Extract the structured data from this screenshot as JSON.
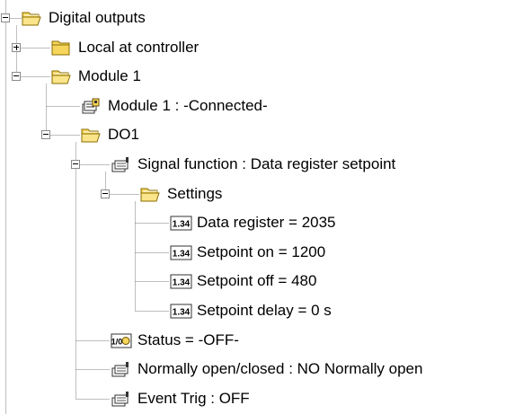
{
  "tree": {
    "nodes": [
      {
        "id": "n0",
        "level": 0,
        "label": "Digital outputs",
        "icon": "folder-open-icon",
        "expander": "expanded"
      },
      {
        "id": "n1",
        "level": 1,
        "label": "Local at controller",
        "icon": "folder-closed-icon",
        "expander": "collapsed"
      },
      {
        "id": "n2",
        "level": 1,
        "label": "Module 1",
        "icon": "folder-open-icon",
        "expander": "expanded"
      },
      {
        "id": "n3",
        "level": 2,
        "label": "Module 1 : -Connected-",
        "icon": "module-icon",
        "expander": "none"
      },
      {
        "id": "n4",
        "level": 2,
        "label": "DO1",
        "icon": "folder-open-icon",
        "expander": "expanded"
      },
      {
        "id": "n5",
        "level": 3,
        "label": "Signal function : Data register setpoint",
        "icon": "parameter-icon",
        "expander": "expanded"
      },
      {
        "id": "n6",
        "level": 4,
        "label": "Settings",
        "icon": "folder-open-icon",
        "expander": "expanded"
      },
      {
        "id": "n7",
        "level": 5,
        "label": "Data register = 2035",
        "icon": "numeric-value-icon",
        "icon_text": "1.34",
        "expander": "none"
      },
      {
        "id": "n8",
        "level": 5,
        "label": "Setpoint on = 1200",
        "icon": "numeric-value-icon",
        "icon_text": "1.34",
        "expander": "none"
      },
      {
        "id": "n9",
        "level": 5,
        "label": "Setpoint off = 480",
        "icon": "numeric-value-icon",
        "icon_text": "1.34",
        "expander": "none"
      },
      {
        "id": "n10",
        "level": 5,
        "label": "Setpoint delay = 0 s",
        "icon": "numeric-value-icon",
        "icon_text": "1.34",
        "expander": "none"
      },
      {
        "id": "n11",
        "level": 3,
        "label": "Status = -OFF-",
        "icon": "io-status-icon",
        "icon_text": "1/0",
        "expander": "none"
      },
      {
        "id": "n12",
        "level": 3,
        "label": "Normally open/closed : NO Normally open",
        "icon": "parameter-icon",
        "expander": "none"
      },
      {
        "id": "n13",
        "level": 3,
        "label": "Event Trig : OFF",
        "icon": "parameter-icon",
        "expander": "none"
      }
    ]
  },
  "colors": {
    "folder_fill": "#f6d55c",
    "folder_edge": "#8a6d00",
    "tree_lines": "#7f7f7f"
  }
}
